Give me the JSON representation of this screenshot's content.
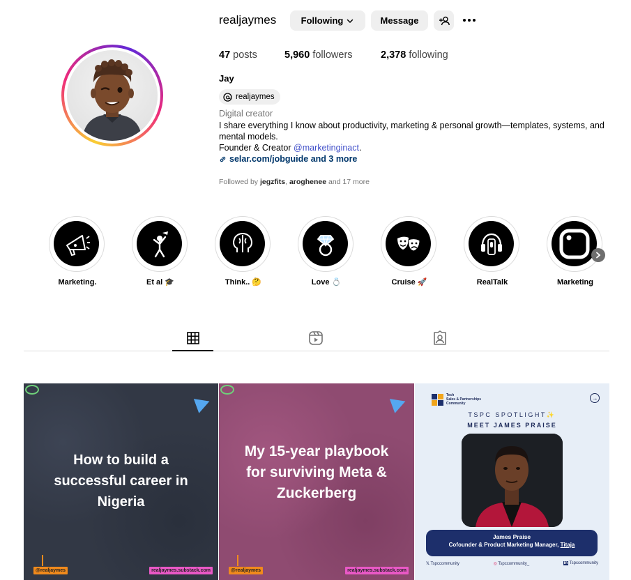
{
  "profile": {
    "username": "realjaymes",
    "following_button": "Following",
    "message_button": "Message",
    "full_name": "Jay",
    "threads_handle": "realjaymes",
    "category": "Digital creator",
    "bio_line1": "I share everything I know about productivity, marketing & personal growth—templates, systems, and mental models.",
    "bio_founder_prefix": "Founder & Creator ",
    "bio_mention": "@marketinginact",
    "bio_founder_suffix": ".",
    "link_text": "selar.com/jobguide and 3 more",
    "followed_by_prefix": "Followed by ",
    "followed_by_user1": "jegzfits",
    "followed_by_sep": ", ",
    "followed_by_user2": "aroghenee",
    "followed_by_suffix": " and 17 more"
  },
  "stats": {
    "posts_count": "47",
    "posts_label": "posts",
    "followers_count": "5,960",
    "followers_label": "followers",
    "following_count": "2,378",
    "following_label": "following"
  },
  "highlights": [
    {
      "label": "Marketing.",
      "icon": "megaphone-icon"
    },
    {
      "label": "Et al 🎓",
      "icon": "graduate-icon"
    },
    {
      "label": "Think.. 🤔",
      "icon": "brain-icon"
    },
    {
      "label": "Love 💍",
      "icon": "ring-icon"
    },
    {
      "label": "Cruise 🚀",
      "icon": "theater-masks-icon"
    },
    {
      "label": "RealTalk",
      "icon": "podcast-icon"
    },
    {
      "label": "Marketing",
      "icon": "app-logo-icon"
    }
  ],
  "tabs": [
    {
      "name": "posts",
      "icon": "grid-icon",
      "active": true
    },
    {
      "name": "reels",
      "icon": "reels-icon",
      "active": false
    },
    {
      "name": "tagged",
      "icon": "tagged-icon",
      "active": false
    }
  ],
  "posts": [
    {
      "title": "How to build a successful career in Nigeria",
      "tag_left": "@realjaymes",
      "tag_right": "realjaymes.substack.com",
      "bg_color": "#323845"
    },
    {
      "title": "My 15-year playbook for surviving Meta & Zuckerberg",
      "tag_left": "@realjaymes",
      "tag_right": "realjaymes.substack.com",
      "bg_color": "#8f4b71"
    },
    {
      "logo_line1": "Tech",
      "logo_line2": "Sales & Partnerships",
      "logo_line3": "Community",
      "spotlight": "TSPC SPOTLIGHT✨",
      "meet": "MEET JAMES PRAISE",
      "name": "James Praise",
      "role_prefix": "Cofounder & Product Marketing Manager, ",
      "role_company": "Titaja",
      "social_x": "Tspccommunity",
      "social_ig": "Tspccommunity_",
      "social_li": "Tspccommunity",
      "bg_color": "#e7eef7"
    }
  ],
  "colors": {
    "link": "#00376b",
    "mention": "#4150c9",
    "muted": "#737373",
    "button_bg": "#efefef"
  }
}
